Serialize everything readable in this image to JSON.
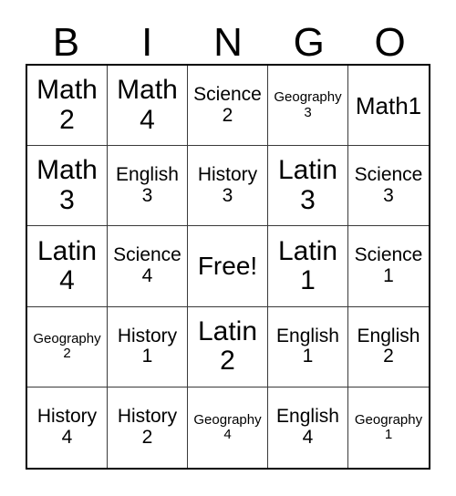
{
  "card": {
    "title": "BINGO",
    "header_letters": [
      "B",
      "I",
      "N",
      "G",
      "O"
    ],
    "columns": 5,
    "rows": 5,
    "colors": {
      "background": "#ffffff",
      "text": "#000000",
      "outer_border": "#000000",
      "inner_border": "#3a3a3a"
    },
    "cells": [
      {
        "word": "Math",
        "number": "2",
        "text": "Math 2",
        "size": "sz-xl",
        "single": false
      },
      {
        "word": "Math",
        "number": "4",
        "text": "Math 4",
        "size": "sz-xl",
        "single": false
      },
      {
        "word": "Science",
        "number": "2",
        "text": "Science 2",
        "size": "sz-md",
        "single": false
      },
      {
        "word": "Geography",
        "number": "3",
        "text": "Geography 3",
        "size": "sz-sm",
        "single": false
      },
      {
        "word": "Math1",
        "number": "",
        "text": "Math1",
        "size": "sz-lg",
        "single": true
      },
      {
        "word": "Math",
        "number": "3",
        "text": "Math 3",
        "size": "sz-xl",
        "single": false
      },
      {
        "word": "English",
        "number": "3",
        "text": "English 3",
        "size": "sz-md",
        "single": false
      },
      {
        "word": "History",
        "number": "3",
        "text": "History 3",
        "size": "sz-md",
        "single": false
      },
      {
        "word": "Latin",
        "number": "3",
        "text": "Latin 3",
        "size": "sz-xl",
        "single": false
      },
      {
        "word": "Science",
        "number": "3",
        "text": "Science 3",
        "size": "sz-md",
        "single": false
      },
      {
        "word": "Latin",
        "number": "4",
        "text": "Latin 4",
        "size": "sz-xl",
        "single": false
      },
      {
        "word": "Science",
        "number": "4",
        "text": "Science 4",
        "size": "sz-md",
        "single": false
      },
      {
        "word": "Free!",
        "number": "",
        "text": "Free!",
        "size": "sz-free",
        "single": true
      },
      {
        "word": "Latin",
        "number": "1",
        "text": "Latin 1",
        "size": "sz-xl",
        "single": false
      },
      {
        "word": "Science",
        "number": "1",
        "text": "Science 1",
        "size": "sz-md",
        "single": false
      },
      {
        "word": "Geography",
        "number": "2",
        "text": "Geography 2",
        "size": "sz-sm",
        "single": false
      },
      {
        "word": "History",
        "number": "1",
        "text": "History 1",
        "size": "sz-md",
        "single": false
      },
      {
        "word": "Latin",
        "number": "2",
        "text": "Latin 2",
        "size": "sz-xl",
        "single": false
      },
      {
        "word": "English",
        "number": "1",
        "text": "English 1",
        "size": "sz-md",
        "single": false
      },
      {
        "word": "English",
        "number": "2",
        "text": "English 2",
        "size": "sz-md",
        "single": false
      },
      {
        "word": "History",
        "number": "4",
        "text": "History 4",
        "size": "sz-md",
        "single": false
      },
      {
        "word": "History",
        "number": "2",
        "text": "History 2",
        "size": "sz-md",
        "single": false
      },
      {
        "word": "Geography",
        "number": "4",
        "text": "Geography 4",
        "size": "sz-sm",
        "single": false
      },
      {
        "word": "English",
        "number": "4",
        "text": "English 4",
        "size": "sz-md",
        "single": false
      },
      {
        "word": "Geography",
        "number": "1",
        "text": "Geography 1",
        "size": "sz-sm",
        "single": false
      }
    ]
  }
}
